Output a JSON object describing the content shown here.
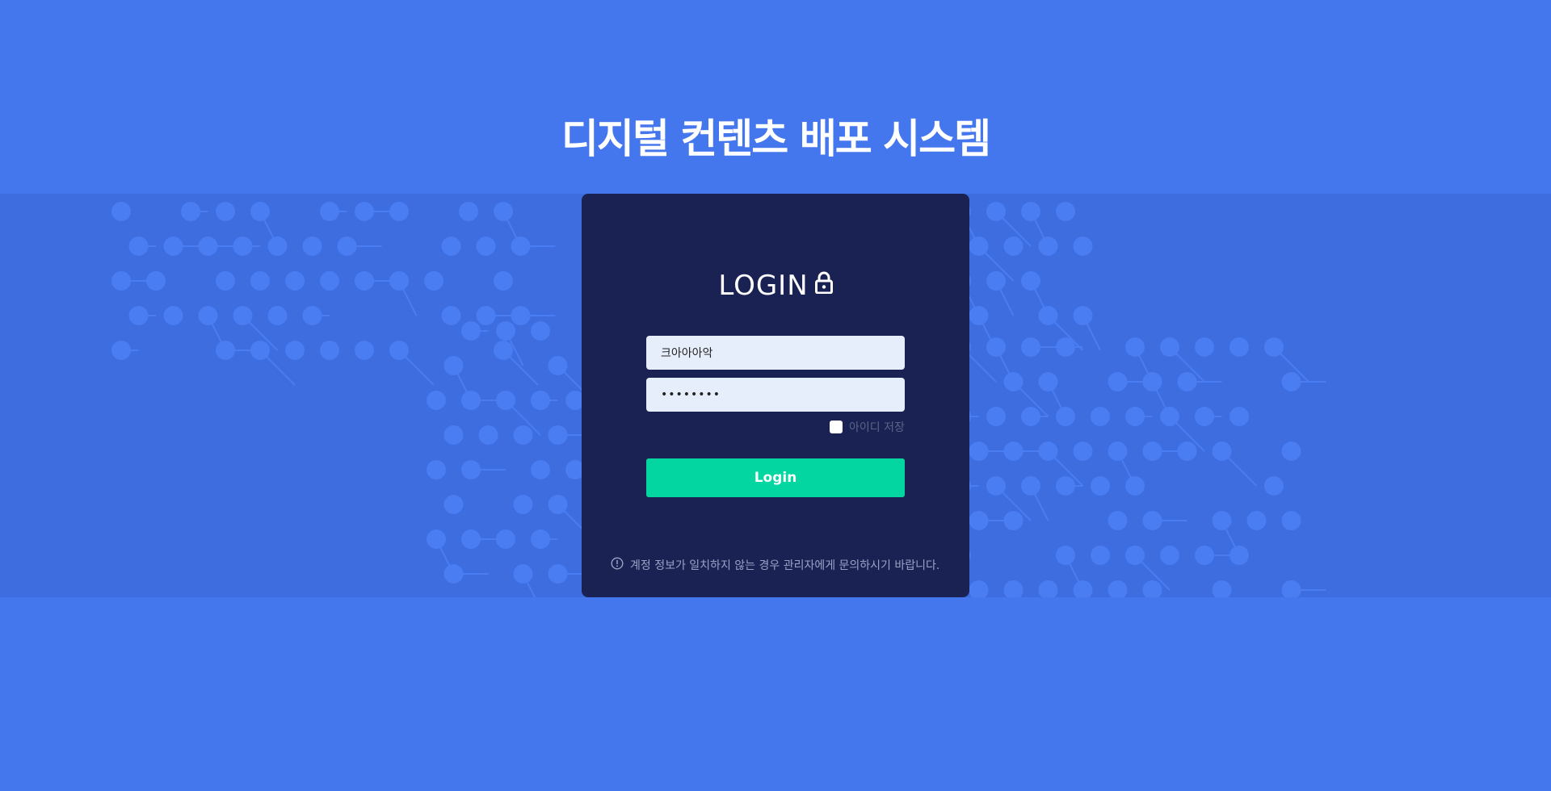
{
  "header": {
    "title": "디지털 컨텐츠 배포 시스템"
  },
  "login": {
    "heading": "LOGIN",
    "heading_icon": "lock-icon",
    "username": {
      "value": "크아아아악",
      "placeholder": ""
    },
    "password": {
      "value": "12345678",
      "placeholder": ""
    },
    "remember_label": "아이디 저장",
    "remember_checked": false,
    "button_label": "Login",
    "notice_icon": "info-circle-icon",
    "notice": "계정 정보가 일치하지 않는 경우 관리자에게 문의하시기 바랍니다."
  },
  "colors": {
    "background": "#4476ee",
    "pattern_band": "#3d6ddf",
    "card": "#1a2254",
    "input_bg": "#e7eefb",
    "accent": "#04d6a2",
    "notice_text": "#9aa2c4"
  }
}
